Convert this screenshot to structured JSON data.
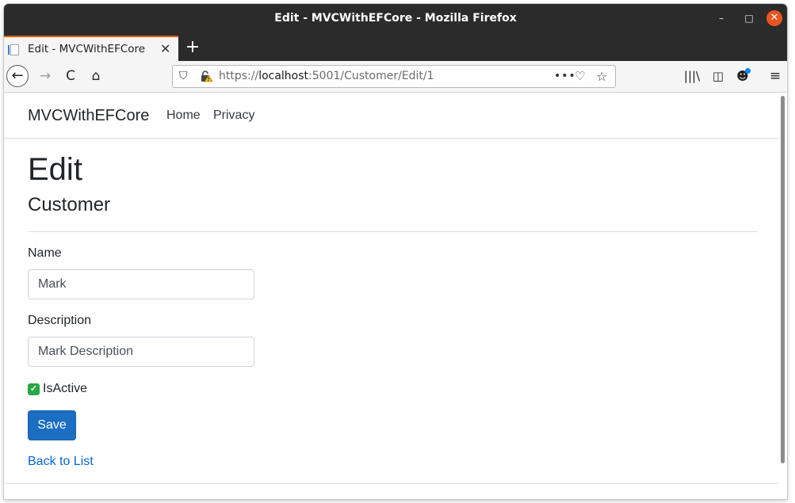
{
  "window": {
    "title": "Edit - MVCWithEFCore - Mozilla Firefox",
    "controls": {
      "minimize": "–",
      "maximize": "□",
      "close": "✕"
    }
  },
  "tabs": [
    {
      "title": "Edit - MVCWithEFCore",
      "close": "✕",
      "active": true
    }
  ],
  "tabbar": {
    "new_tab": "+"
  },
  "toolbar": {
    "back": "←",
    "forward": "→",
    "reload": "C",
    "home": "⌂",
    "url_protocol": "https://",
    "url_host": "localhost",
    "url_path": ":5001/Customer/Edit/1",
    "url_shield": "⛉",
    "page_actions": "•••",
    "pocket": "♡",
    "bookmark": "☆",
    "library": "|||\\",
    "sidebar": "◫",
    "account": "☻",
    "menu": "≡",
    "accent_color": "#e66000",
    "notification_color": "#0a84ff"
  },
  "site": {
    "brand": "MVCWithEFCore",
    "nav": [
      {
        "label": "Home"
      },
      {
        "label": "Privacy"
      }
    ]
  },
  "page": {
    "heading": "Edit",
    "subheading": "Customer",
    "form": {
      "name_label": "Name",
      "name_value": "Mark",
      "description_label": "Description",
      "description_value": "Mark Description",
      "isactive_label": "IsActive",
      "isactive_checked": true,
      "save_label": "Save"
    },
    "back_link": "Back to List"
  },
  "colors": {
    "primary_button": "#1b6ec2",
    "link": "#0366d6",
    "checkbox": "#28a745",
    "titlebar": "#2b2b2b",
    "close_button": "#e95420"
  }
}
